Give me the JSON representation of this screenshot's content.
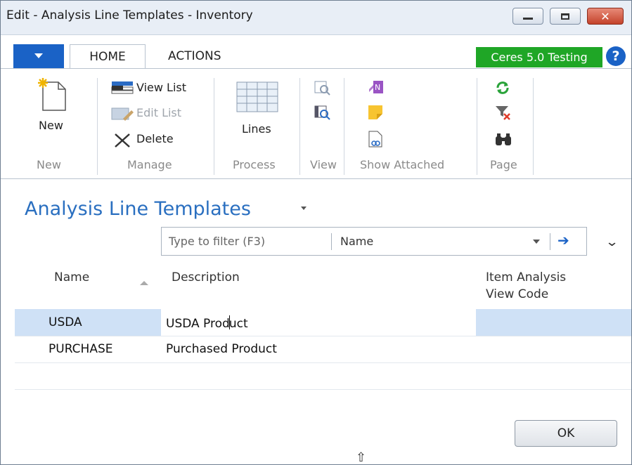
{
  "window": {
    "title": "Edit - Analysis Line Templates - Inventory",
    "controls": {
      "minimize": "minimize",
      "maximize": "maximize",
      "close": "✕"
    }
  },
  "tabs": {
    "home": "HOME",
    "actions": "ACTIONS"
  },
  "environment_badge": "Ceres 5.0 Testing",
  "help": "?",
  "ribbon": {
    "new_group": {
      "new_label": "New",
      "group_label": "New"
    },
    "manage_group": {
      "view_list": "View List",
      "edit_list": "Edit List",
      "delete": "Delete",
      "group_label": "Manage"
    },
    "process_group": {
      "lines": "Lines",
      "group_label": "Process"
    },
    "view_group": {
      "group_label": "View"
    },
    "show_attached_group": {
      "group_label": "Show Attached"
    },
    "page_group": {
      "group_label": "Page"
    }
  },
  "page": {
    "title": "Analysis Line Templates"
  },
  "filter": {
    "placeholder": "Type to filter (F3)",
    "field": "Name"
  },
  "table": {
    "headers": {
      "name": "Name",
      "description": "Description",
      "item_view_line1": "Item Analysis",
      "item_view_line2": "View Code"
    },
    "rows": [
      {
        "name": "USDA",
        "description_a": "USDA Prod",
        "description_b": "uct",
        "item_view": ""
      },
      {
        "name": "PURCHASE",
        "description": "Purchased Product",
        "item_view": ""
      }
    ]
  },
  "footer": {
    "ok": "OK",
    "resize_glyph": "⇧"
  },
  "colors": {
    "accent": "#1a62c6",
    "title_blue": "#2a6fc0",
    "badge_green": "#1fa626",
    "selected_row": "#cfe1f6"
  }
}
